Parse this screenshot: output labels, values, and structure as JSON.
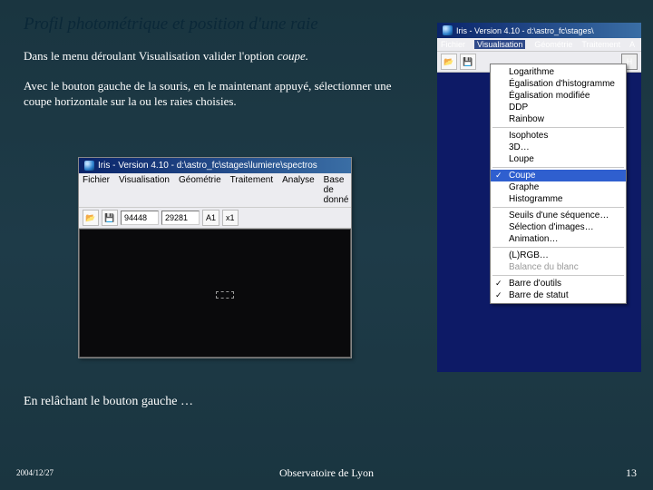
{
  "title": "Profil photométrique et position d'une raie",
  "para1_a": "Dans le menu déroulant Visualisation valider l'option ",
  "para1_b": "coupe.",
  "para2": "Avec le bouton gauche de la souris, en le maintenant appuyé, sélectionner une coupe horizontale sur la ou les raies choisies.",
  "continue": "En relâchant le bouton gauche …",
  "footer": {
    "date": "2004/12/27",
    "org": "Observatoire de Lyon",
    "page": "13"
  },
  "iris_left": {
    "title": "Iris - Version 4.10 - d:\\astro_fc\\stages\\lumiere\\spectros",
    "menubar": [
      "Fichier",
      "Visualisation",
      "Géométrie",
      "Traitement",
      "Analyse",
      "Base de donné"
    ],
    "fields": [
      "94448",
      "29281"
    ],
    "zoom": "x1"
  },
  "iris_right": {
    "title": "Iris - Version 4.10 - d:\\astro_fc\\stages\\",
    "menubar": [
      "Fichier",
      "Visualisation",
      "Géométrie",
      "Traitement",
      "A"
    ],
    "items": [
      {
        "label": "Logarithme",
        "type": "item"
      },
      {
        "label": "Égalisation d'histogramme",
        "type": "item"
      },
      {
        "label": "Égalisation modifiée",
        "type": "item"
      },
      {
        "label": "DDP",
        "type": "item"
      },
      {
        "label": "Rainbow",
        "type": "item"
      },
      {
        "label": "",
        "type": "sep"
      },
      {
        "label": "Isophotes",
        "type": "item"
      },
      {
        "label": "3D…",
        "type": "item"
      },
      {
        "label": "Loupe",
        "type": "item"
      },
      {
        "label": "",
        "type": "sep"
      },
      {
        "label": "Coupe",
        "type": "selected",
        "check": true
      },
      {
        "label": "Graphe",
        "type": "item"
      },
      {
        "label": "Histogramme",
        "type": "item"
      },
      {
        "label": "",
        "type": "sep"
      },
      {
        "label": "Seuils d'une séquence…",
        "type": "item"
      },
      {
        "label": "Sélection d'images…",
        "type": "item"
      },
      {
        "label": "Animation…",
        "type": "item"
      },
      {
        "label": "",
        "type": "sep"
      },
      {
        "label": "(L)RGB…",
        "type": "item"
      },
      {
        "label": "Balance du blanc",
        "type": "disabled"
      },
      {
        "label": "",
        "type": "sep"
      },
      {
        "label": "Barre d'outils",
        "type": "item",
        "check": true
      },
      {
        "label": "Barre de statut",
        "type": "item",
        "check": true
      }
    ]
  }
}
